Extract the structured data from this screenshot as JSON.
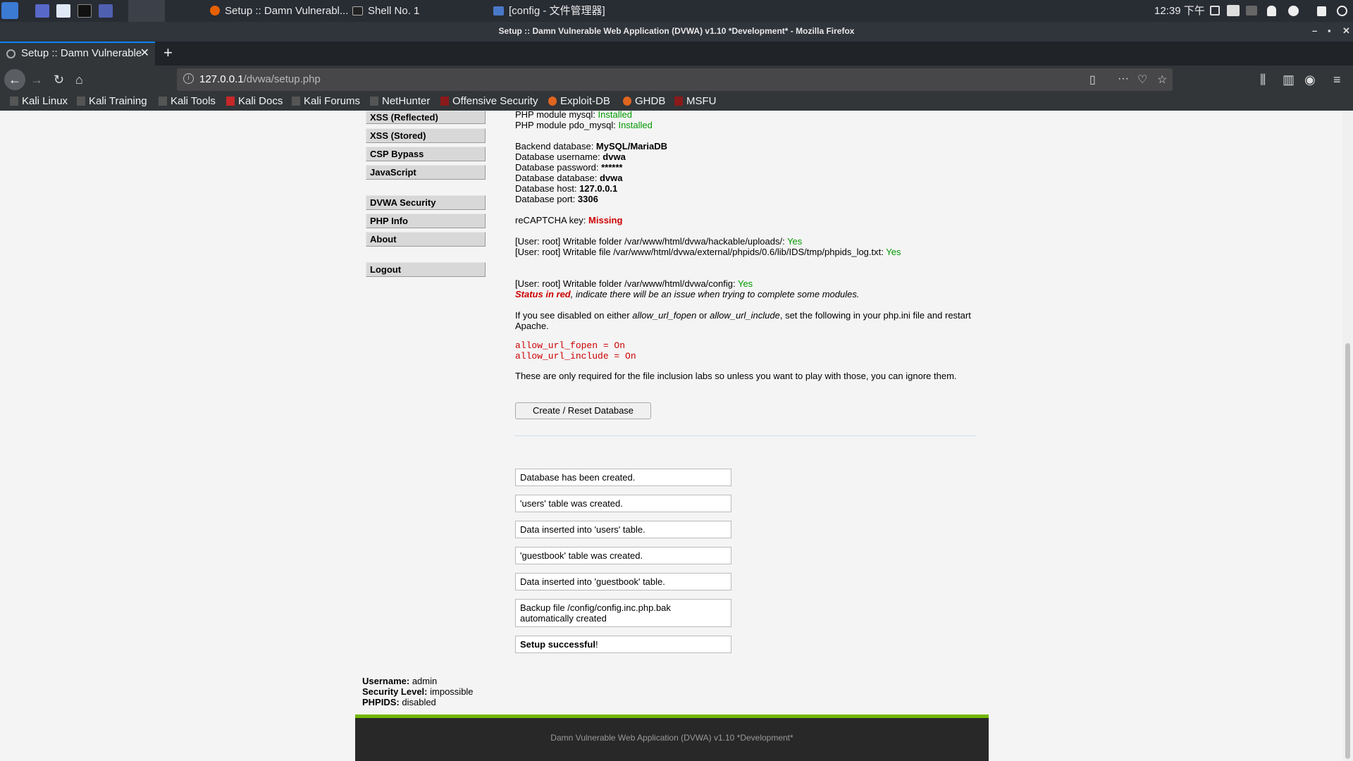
{
  "taskbar": {
    "tasks": [
      "Setup :: Damn Vulnerabl...",
      "Shell No. 1",
      "[config - 文件管理器]"
    ],
    "clock": "12:39 下午"
  },
  "window": {
    "title": "Setup :: Damn Vulnerable Web Application (DVWA) v1.10 *Development* - Mozilla Firefox"
  },
  "browser": {
    "tab_title": "Setup :: Damn Vulnerable",
    "url_host": "127.0.0.1",
    "url_path": "/dvwa/setup.php",
    "bookmarks": [
      "Kali Linux",
      "Kali Training",
      "Kali Tools",
      "Kali Docs",
      "Kali Forums",
      "NetHunter",
      "Offensive Security",
      "Exploit-DB",
      "GHDB",
      "MSFU"
    ]
  },
  "menu": {
    "items": [
      "XSS (Reflected)",
      "XSS (Stored)",
      "CSP Bypass",
      "JavaScript",
      "DVWA Security",
      "PHP Info",
      "About",
      "Logout"
    ]
  },
  "setup": {
    "mysql_label": "PHP module mysql: ",
    "mysql_val": "Installed",
    "pdo_label": "PHP module pdo_mysql: ",
    "pdo_val": "Installed",
    "db_backend_label": "Backend database: ",
    "db_backend": "MySQL/MariaDB",
    "db_user_label": "Database username: ",
    "db_user": "dvwa",
    "db_pass_label": "Database password: ",
    "db_pass": "******",
    "db_name_label": "Database database: ",
    "db_name": "dvwa",
    "db_host_label": "Database host: ",
    "db_host": "127.0.0.1",
    "db_port_label": "Database port: ",
    "db_port": "3306",
    "recaptcha_label": "reCAPTCHA key: ",
    "recaptcha_val": "Missing",
    "w1": "[User: root] Writable folder /var/www/html/dvwa/hackable/uploads/: ",
    "w1_val": "Yes",
    "w2": "[User: root] Writable file /var/www/html/dvwa/external/phpids/0.6/lib/IDS/tmp/phpids_log.txt: ",
    "w2_val": "Yes",
    "w3": "[User: root] Writable folder /var/www/html/dvwa/config: ",
    "w3_val": "Yes",
    "status_red": "Status in red",
    "status_rest": ", indicate there will be an issue when trying to complete some modules.",
    "ini_1": "If you see disabled on either ",
    "ini_fopen": "allow_url_fopen",
    "ini_or": " or ",
    "ini_include": "allow_url_include",
    "ini_2": ", set the following in your php.ini file and restart",
    "ini_3": "Apache.",
    "code1": "allow_url_fopen = On",
    "code2": "allow_url_include = On",
    "only_req": "These are only required for the file inclusion labs so unless you want to play with those, you can ignore them.",
    "button": "Create / Reset Database"
  },
  "messages": [
    "Database has been created.",
    "'users' table was created.",
    "Data inserted into 'users' table.",
    "'guestbook' table was created.",
    "Data inserted into 'guestbook' table.",
    "Backup file /config/config.inc.php.bak automatically created"
  ],
  "success": {
    "bold": "Setup successful",
    "rest": "!"
  },
  "userinfo": {
    "username_label": "Username:",
    "username": "admin",
    "security_label": "Security Level:",
    "security": "impossible",
    "phpids_label": "PHPIDS:",
    "phpids": "disabled"
  },
  "footer": "Damn Vulnerable Web Application (DVWA) v1.10 *Development*"
}
